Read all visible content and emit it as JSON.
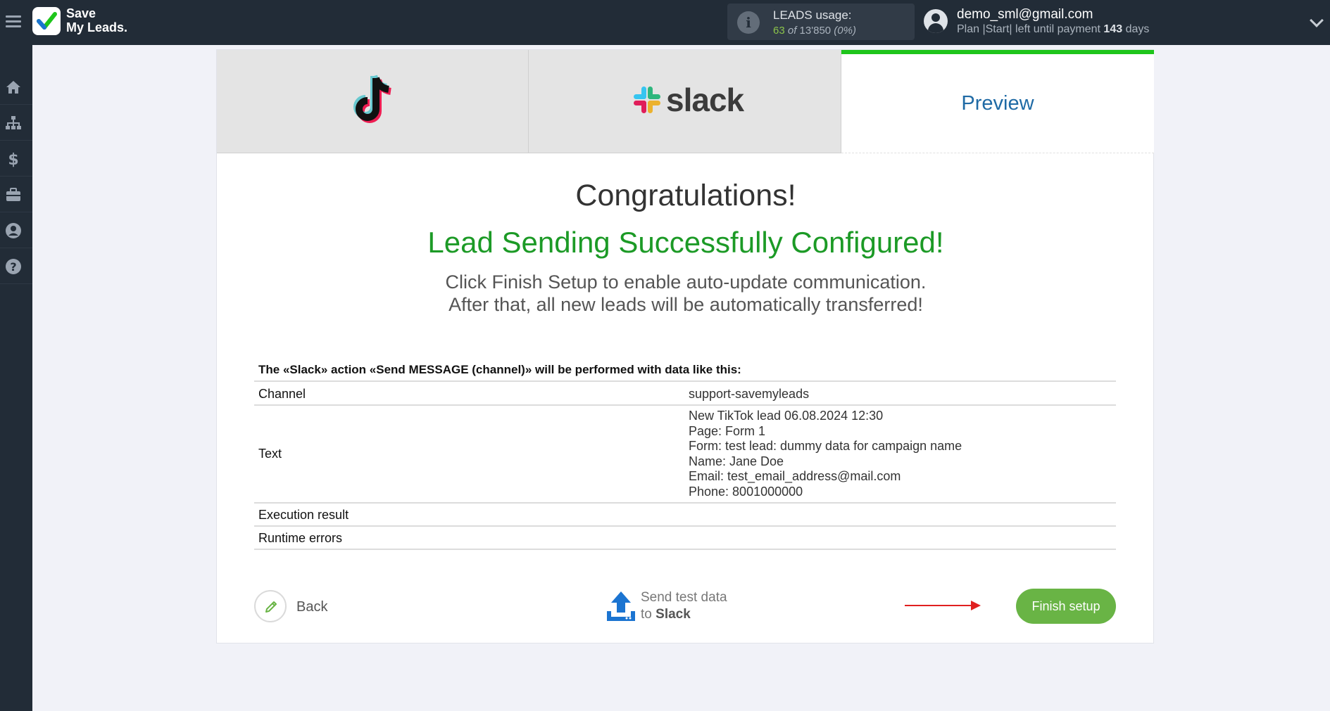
{
  "header": {
    "logo_line1": "Save",
    "logo_line2": "My Leads.",
    "usage_title": "LEADS usage:",
    "usage_used": "63",
    "usage_of": "of",
    "usage_total": "13'850",
    "usage_percent": "(0%)",
    "user_email": "demo_sml@gmail.com",
    "plan_text": "Plan |Start| left until payment",
    "plan_days_value": "143",
    "plan_days_unit": "days"
  },
  "sidebar": {
    "items": [
      {
        "name": "home",
        "icon": "home-icon"
      },
      {
        "name": "connections",
        "icon": "sitemap-icon"
      },
      {
        "name": "billing",
        "icon": "dollar-icon"
      },
      {
        "name": "tools",
        "icon": "briefcase-icon"
      },
      {
        "name": "account",
        "icon": "user-circle-icon"
      },
      {
        "name": "help",
        "icon": "question-circle-icon"
      }
    ]
  },
  "tabs": {
    "source": "tiktok",
    "destination_word": "slack",
    "preview_label": "Preview"
  },
  "main": {
    "congrats": "Congratulations!",
    "success": "Lead Sending Successfully Configured!",
    "desc_line1": "Click Finish Setup to enable auto-update communication.",
    "desc_line2": "After that, all new leads will be automatically transferred!",
    "data_title": "The «Slack» action «Send MESSAGE (channel)» will be performed with data like this:",
    "rows": {
      "channel_label": "Channel",
      "channel_value": "support-savemyleads",
      "text_label": "Text",
      "text_lines": [
        "New TikTok lead 06.08.2024 12:30",
        "Page: Form 1",
        "Form: test lead: dummy data for campaign name",
        "Name: Jane Doe",
        "Email: test_email_address@mail.com",
        "Phone: 8001000000"
      ],
      "execution_label": "Execution result",
      "runtime_label": "Runtime errors"
    }
  },
  "actions": {
    "back_label": "Back",
    "send_line1": "Send test data",
    "send_line2_prefix": "to",
    "send_line2_bold": "Slack",
    "finish_label": "Finish setup"
  },
  "colors": {
    "topbar": "#222c37",
    "accent_green": "#1c9a26",
    "button_green": "#69b445",
    "tab_active_border": "#1ec51b",
    "preview_blue": "#1f6aa5",
    "arrow_red": "#e02020"
  }
}
